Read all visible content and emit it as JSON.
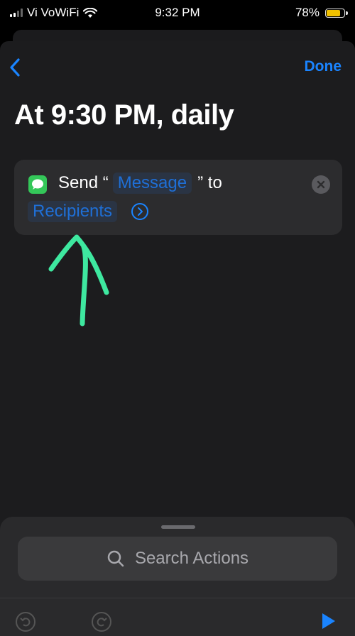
{
  "status_bar": {
    "carrier": "Vi VoWiFi",
    "time": "9:32 PM",
    "battery": "78%",
    "battery_level": 0.78
  },
  "nav": {
    "back_icon": "chevron-left-icon",
    "done_label": "Done"
  },
  "title": "At 9:30 PM, daily",
  "action": {
    "icon": "messages-app-icon",
    "send_label": "Send “",
    "message_token": "Message",
    "to_label": "” to",
    "recipients_token": "Recipients",
    "expand_icon": "chevron-right-circle-icon",
    "clear_icon": "close-circle-icon"
  },
  "annotation": {
    "type": "hand-drawn-arrow",
    "color": "#3ee8a0"
  },
  "bottom_sheet": {
    "search_placeholder": "Search Actions",
    "search_icon": "magnifying-glass-icon",
    "undo_icon": "undo-icon",
    "redo_icon": "redo-icon",
    "run_icon": "play-icon"
  },
  "colors": {
    "accent": "#1a84ff",
    "background": "#1c1c1e",
    "card": "#2c2c2e",
    "messages_green": "#34c759",
    "battery_yellow": "#f2c200"
  }
}
